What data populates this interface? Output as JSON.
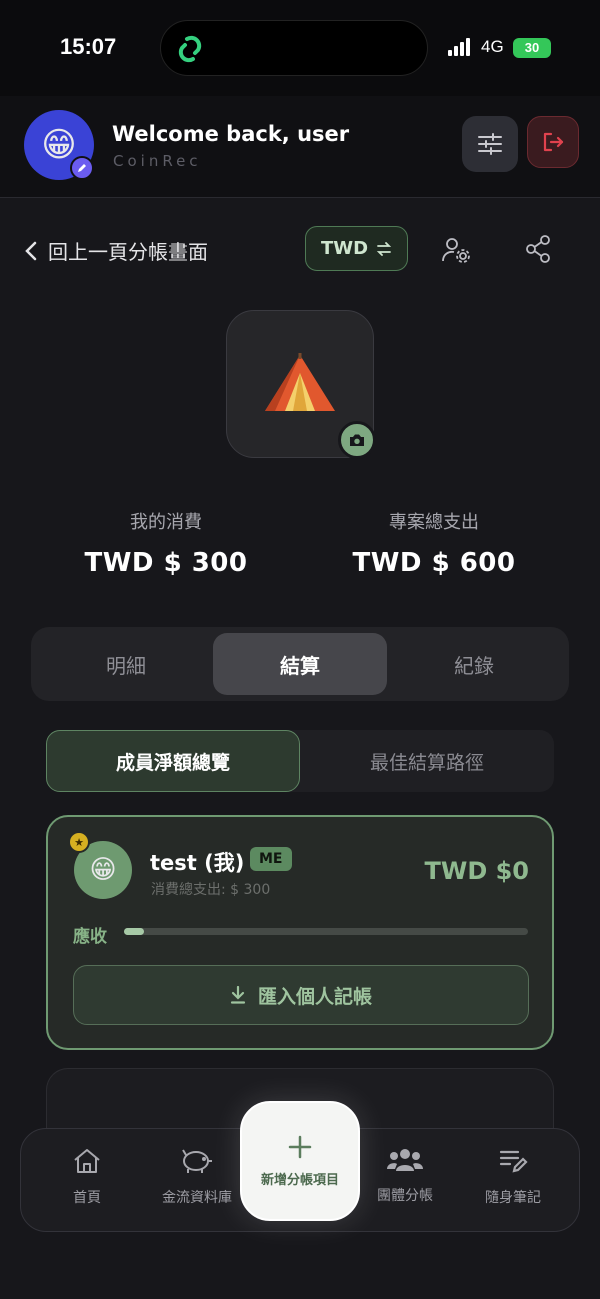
{
  "status_bar": {
    "time": "15:07",
    "network": "4G",
    "battery": "30"
  },
  "header": {
    "title": "Welcome back, user",
    "subtitle": "CoinRec",
    "avatar_emoji": "😁"
  },
  "nav": {
    "back_label": "回上一頁分帳畫面",
    "currency": "TWD"
  },
  "project": {
    "icon_emoji": "⛺"
  },
  "stats": {
    "my_label": "我的消費",
    "my_value": "TWD $ 300",
    "total_label": "專案總支出",
    "total_value": "TWD $ 600"
  },
  "main_tabs": [
    {
      "label": "明細",
      "active": false
    },
    {
      "label": "結算",
      "active": true
    },
    {
      "label": "紀錄",
      "active": false
    }
  ],
  "sub_tabs": [
    {
      "label": "成員淨額總覽",
      "active": true
    },
    {
      "label": "最佳結算路徑",
      "active": false
    }
  ],
  "member": {
    "avatar_emoji": "😁",
    "name": "test (我)",
    "badge": "ME",
    "spent": "消費總支出: $ 300",
    "amount": "TWD $0",
    "status_label": "應收",
    "progress": 0.05,
    "import_label": "匯入個人記帳"
  },
  "bottom_nav": {
    "home": "首頁",
    "library": "金流資料庫",
    "fab": "新增分帳項目",
    "group": "團體分帳",
    "notes": "隨身筆記"
  },
  "colors": {
    "accent_green": "#6f9a72",
    "danger": "#e0424e",
    "background": "#17171b"
  }
}
